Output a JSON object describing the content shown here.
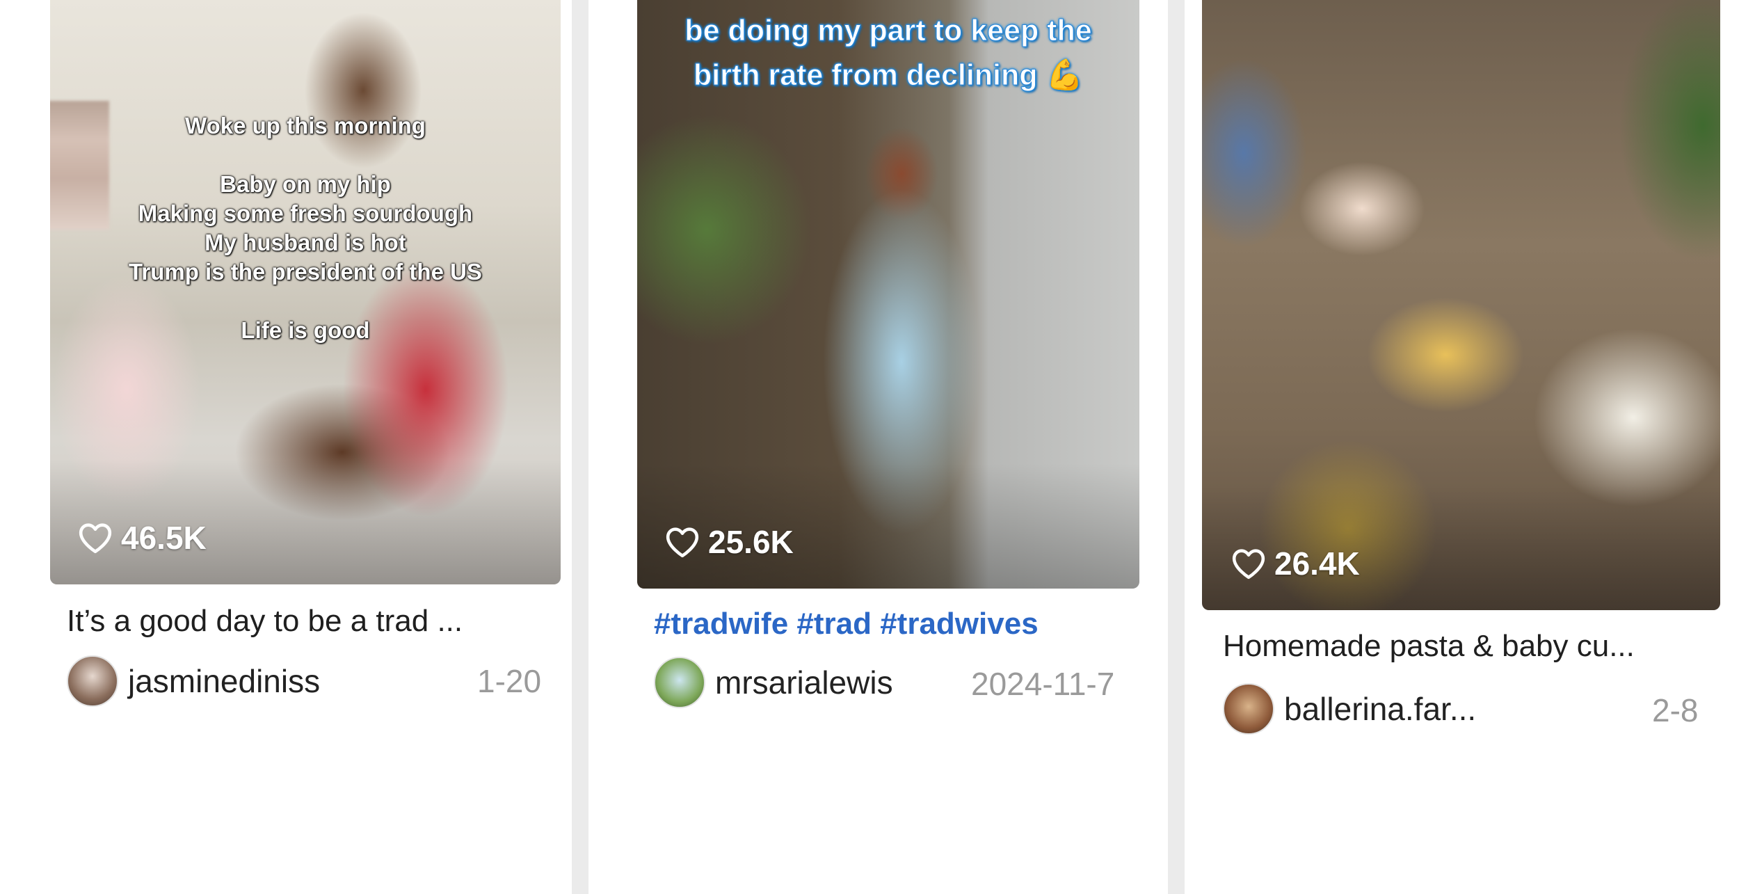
{
  "cards": [
    {
      "overlay_lines": [
        "Woke up this morning",
        "",
        "Baby on my hip",
        "Making some fresh sourdough",
        "My husband is hot",
        "Trump is the president of the US",
        "",
        "Life is good"
      ],
      "likes": "46.5K",
      "title": "It’s a good day to be a trad ...",
      "author": "jasminediniss",
      "date": "1-20"
    },
    {
      "overlay_lines": [
        "be doing my part to keep the",
        "birth rate from declining 💪"
      ],
      "likes": "25.6K",
      "title": "#tradwife #trad #tradwives",
      "author": "mrsarialewis",
      "date": "2024-11-7"
    },
    {
      "overlay_lines": [],
      "likes": "26.4K",
      "title": "Homemade pasta & baby cu...",
      "author": "ballerina.far...",
      "date": "2-8"
    }
  ],
  "icons": {
    "likes": "heart-outline-icon"
  },
  "colors": {
    "background_gap": "#ebebeb",
    "card_background": "#ffffff",
    "hashtag": "#2b67c6",
    "date": "#9a9a9a",
    "overlay_text_outline": "#1c8fe0"
  }
}
